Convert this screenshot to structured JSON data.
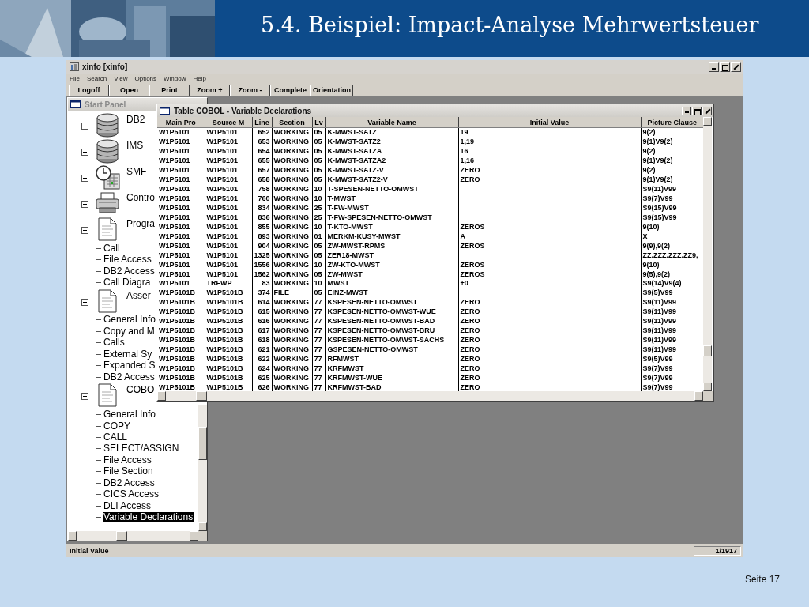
{
  "slide": {
    "title": "5.4. Beispiel: Impact-Analyse Mehrwertsteuer",
    "page": "Seite 17"
  },
  "app": {
    "title": "xinfo [xinfo]",
    "menu": [
      "File",
      "Search",
      "View",
      "Options",
      "Window",
      "Help"
    ],
    "toolbar": [
      "Logoff",
      "Open",
      "Print",
      "Zoom +",
      "Zoom -",
      "Complete",
      "Orientation"
    ],
    "status": {
      "field": "Initial Value",
      "position": "1/1917"
    }
  },
  "start_panel": {
    "title": "Start Panel",
    "active": false,
    "tree": [
      {
        "label": "DB2",
        "kind": "database",
        "expanded": false,
        "selected": false
      },
      {
        "label": "IMS",
        "kind": "database",
        "expanded": false,
        "selected": false
      },
      {
        "label": "SMF",
        "kind": "clock",
        "expanded": false,
        "selected": false
      },
      {
        "label": "Contro",
        "kind": "printer",
        "expanded": false,
        "selected": false
      },
      {
        "label": "Progra",
        "kind": "document",
        "expanded": true,
        "selected": false,
        "children": [
          {
            "label": "Call",
            "selected": false
          },
          {
            "label": "File Access",
            "selected": false
          },
          {
            "label": "DB2 Access",
            "selected": false
          },
          {
            "label": "Call Diagra",
            "selected": false
          }
        ]
      },
      {
        "label": "Asser",
        "kind": "document",
        "expanded": true,
        "selected": false,
        "children": [
          {
            "label": "General Info",
            "selected": false
          },
          {
            "label": "Copy and M",
            "selected": false
          },
          {
            "label": "Calls",
            "selected": false
          },
          {
            "label": "External Sy",
            "selected": false
          },
          {
            "label": "Expanded S",
            "selected": false
          },
          {
            "label": "DB2 Access",
            "selected": false
          }
        ]
      },
      {
        "label": "COBO",
        "kind": "document",
        "expanded": true,
        "selected": false,
        "children": [
          {
            "label": "General Info",
            "selected": false
          },
          {
            "label": "COPY",
            "selected": false
          },
          {
            "label": "CALL",
            "selected": false
          },
          {
            "label": "SELECT/ASSIGN",
            "selected": false
          },
          {
            "label": "File Access",
            "selected": false
          },
          {
            "label": "File Section",
            "selected": false
          },
          {
            "label": "DB2 Access",
            "selected": false
          },
          {
            "label": "CICS Access",
            "selected": false
          },
          {
            "label": "DLI Access",
            "selected": false
          },
          {
            "label": "Variable Declarations",
            "selected": true
          }
        ]
      }
    ]
  },
  "table_window": {
    "title": "Table COBOL - Variable Declarations",
    "active": true,
    "columns": [
      "Main Pro",
      "Source M",
      "Line",
      "Section",
      "Lv",
      "Variable Name",
      "Initial Value",
      "Picture Clause"
    ],
    "rows": [
      {
        "main_pro": "W1P5101",
        "source_m": "W1P5101",
        "line": "652",
        "section": "WORKING",
        "lv": "05",
        "variable_name": "K-MWST-SATZ",
        "initial_value": "19",
        "picture_clause": "9(2)"
      },
      {
        "main_pro": "W1P5101",
        "source_m": "W1P5101",
        "line": "653",
        "section": "WORKING",
        "lv": "05",
        "variable_name": "K-MWST-SATZ2",
        "initial_value": "1,19",
        "picture_clause": "9(1)V9(2)"
      },
      {
        "main_pro": "W1P5101",
        "source_m": "W1P5101",
        "line": "654",
        "section": "WORKING",
        "lv": "05",
        "variable_name": "K-MWST-SATZA",
        "initial_value": "16",
        "picture_clause": "9(2)"
      },
      {
        "main_pro": "W1P5101",
        "source_m": "W1P5101",
        "line": "655",
        "section": "WORKING",
        "lv": "05",
        "variable_name": "K-MWST-SATZA2",
        "initial_value": "1,16",
        "picture_clause": "9(1)V9(2)"
      },
      {
        "main_pro": "W1P5101",
        "source_m": "W1P5101",
        "line": "657",
        "section": "WORKING",
        "lv": "05",
        "variable_name": "K-MWST-SATZ-V",
        "initial_value": "ZERO",
        "picture_clause": "9(2)"
      },
      {
        "main_pro": "W1P5101",
        "source_m": "W1P5101",
        "line": "658",
        "section": "WORKING",
        "lv": "05",
        "variable_name": "K-MWST-SATZ2-V",
        "initial_value": "ZERO",
        "picture_clause": "9(1)V9(2)"
      },
      {
        "main_pro": "W1P5101",
        "source_m": "W1P5101",
        "line": "758",
        "section": "WORKING",
        "lv": "10",
        "variable_name": "T-SPESEN-NETTO-OMWST",
        "picture_clause": "S9(11)V99"
      },
      {
        "main_pro": "W1P5101",
        "source_m": "W1P5101",
        "line": "760",
        "section": "WORKING",
        "lv": "10",
        "variable_name": "T-MWST",
        "picture_clause": "S9(7)V99"
      },
      {
        "main_pro": "W1P5101",
        "source_m": "W1P5101",
        "line": "834",
        "section": "WORKING",
        "lv": "25",
        "variable_name": "T-FW-MWST",
        "picture_clause": "S9(15)V99"
      },
      {
        "main_pro": "W1P5101",
        "source_m": "W1P5101",
        "line": "836",
        "section": "WORKING",
        "lv": "25",
        "variable_name": "T-FW-SPESEN-NETTO-OMWST",
        "picture_clause": "S9(15)V99"
      },
      {
        "main_pro": "W1P5101",
        "source_m": "W1P5101",
        "line": "855",
        "section": "WORKING",
        "lv": "10",
        "variable_name": "T-KTO-MWST",
        "initial_value": "ZEROS",
        "picture_clause": "9(10)"
      },
      {
        "main_pro": "W1P5101",
        "source_m": "W1P5101",
        "line": "893",
        "section": "WORKING",
        "lv": "01",
        "variable_name": "MERKM-KUSY-MWST",
        "initial_value": "A",
        "picture_clause": "X"
      },
      {
        "main_pro": "W1P5101",
        "source_m": "W1P5101",
        "line": "904",
        "section": "WORKING",
        "lv": "05",
        "variable_name": "ZW-MWST-RPMS",
        "initial_value": "ZEROS",
        "picture_clause": "9(9),9(2)"
      },
      {
        "main_pro": "W1P5101",
        "source_m": "W1P5101",
        "line": "1325",
        "section": "WORKING",
        "lv": "05",
        "variable_name": "ZER18-MWST",
        "picture_clause": "ZZ.ZZZ.ZZZ.ZZ9,"
      },
      {
        "main_pro": "W1P5101",
        "source_m": "W1P5101",
        "line": "1556",
        "section": "WORKING",
        "lv": "10",
        "variable_name": "ZW-KTO-MWST",
        "initial_value": "ZEROS",
        "picture_clause": "9(10)"
      },
      {
        "main_pro": "W1P5101",
        "source_m": "W1P5101",
        "line": "1562",
        "section": "WORKING",
        "lv": "05",
        "variable_name": "ZW-MWST",
        "initial_value": "ZEROS",
        "picture_clause": "9(5),9(2)"
      },
      {
        "main_pro": "W1P5101",
        "source_m": "TRFWP",
        "line": "83",
        "section": "WORKING",
        "lv": "10",
        "variable_name": "MWST",
        "initial_value": "+0",
        "picture_clause": "S9(14)V9(4)"
      },
      {
        "main_pro": "W1P5101B",
        "source_m": "W1P5101B",
        "line": "374",
        "section": "FILE",
        "lv": "05",
        "variable_name": "EINZ-MWST",
        "picture_clause": "S9(5)V99"
      },
      {
        "main_pro": "W1P5101B",
        "source_m": "W1P5101B",
        "line": "614",
        "section": "WORKING",
        "lv": "77",
        "variable_name": "KSPESEN-NETTO-OMWST",
        "initial_value": "ZERO",
        "picture_clause": "S9(11)V99"
      },
      {
        "main_pro": "W1P5101B",
        "source_m": "W1P5101B",
        "line": "615",
        "section": "WORKING",
        "lv": "77",
        "variable_name": "KSPESEN-NETTO-OMWST-WUE",
        "initial_value": "ZERO",
        "picture_clause": "S9(11)V99"
      },
      {
        "main_pro": "W1P5101B",
        "source_m": "W1P5101B",
        "line": "616",
        "section": "WORKING",
        "lv": "77",
        "variable_name": "KSPESEN-NETTO-OMWST-BAD",
        "initial_value": "ZERO",
        "picture_clause": "S9(11)V99"
      },
      {
        "main_pro": "W1P5101B",
        "source_m": "W1P5101B",
        "line": "617",
        "section": "WORKING",
        "lv": "77",
        "variable_name": "KSPESEN-NETTO-OMWST-BRU",
        "initial_value": "ZERO",
        "picture_clause": "S9(11)V99"
      },
      {
        "main_pro": "W1P5101B",
        "source_m": "W1P5101B",
        "line": "618",
        "section": "WORKING",
        "lv": "77",
        "variable_name": "KSPESEN-NETTO-OMWST-SACHS",
        "initial_value": "ZERO",
        "picture_clause": "S9(11)V99"
      },
      {
        "main_pro": "W1P5101B",
        "source_m": "W1P5101B",
        "line": "621",
        "section": "WORKING",
        "lv": "77",
        "variable_name": "GSPESEN-NETTO-OMWST",
        "initial_value": "ZERO",
        "picture_clause": "S9(11)V99"
      },
      {
        "main_pro": "W1P5101B",
        "source_m": "W1P5101B",
        "line": "622",
        "section": "WORKING",
        "lv": "77",
        "variable_name": "RFMWST",
        "initial_value": "ZERO",
        "picture_clause": "S9(5)V99"
      },
      {
        "main_pro": "W1P5101B",
        "source_m": "W1P5101B",
        "line": "624",
        "section": "WORKING",
        "lv": "77",
        "variable_name": "KRFMWST",
        "initial_value": "ZERO",
        "picture_clause": "S9(7)V99"
      },
      {
        "main_pro": "W1P5101B",
        "source_m": "W1P5101B",
        "line": "625",
        "section": "WORKING",
        "lv": "77",
        "variable_name": "KRFMWST-WUE",
        "initial_value": "ZERO",
        "picture_clause": "S9(7)V99"
      },
      {
        "main_pro": "W1P5101B",
        "source_m": "W1P5101B",
        "line": "626",
        "section": "WORKING",
        "lv": "77",
        "variable_name": "KRFMWST-BAD",
        "initial_value": "ZERO",
        "picture_clause": "S9(7)V99"
      }
    ]
  }
}
